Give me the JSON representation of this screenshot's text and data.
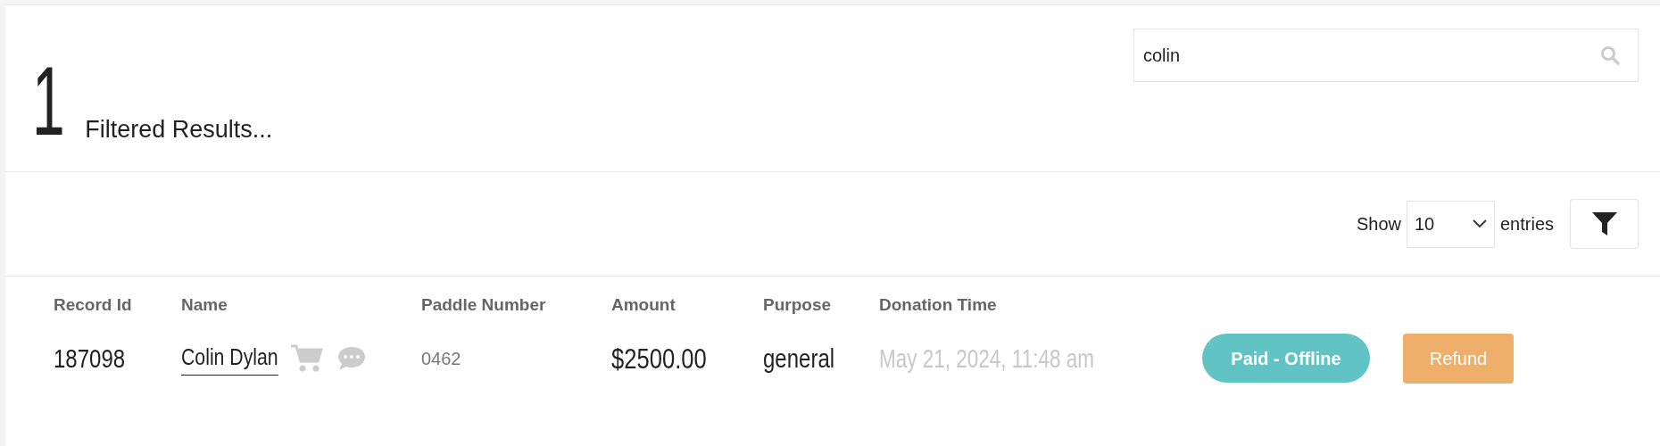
{
  "summary": {
    "count": "1",
    "label": "Filtered Results..."
  },
  "search": {
    "value": "colin"
  },
  "length_control": {
    "prefix": "Show",
    "value": "10",
    "suffix": "entries"
  },
  "table": {
    "columns": [
      "Record Id",
      "Name",
      "Paddle Number",
      "Amount",
      "Purpose",
      "Donation Time"
    ],
    "rows": [
      {
        "record_id": "187098",
        "name": "Colin Dylan",
        "paddle_number": "0462",
        "amount": "$2500.00",
        "purpose": "general",
        "donation_time": "May 21, 2024, 11:48 am",
        "status": {
          "label": "Paid - Offline",
          "color": "#62c3c4"
        },
        "action": "Refund"
      }
    ]
  }
}
